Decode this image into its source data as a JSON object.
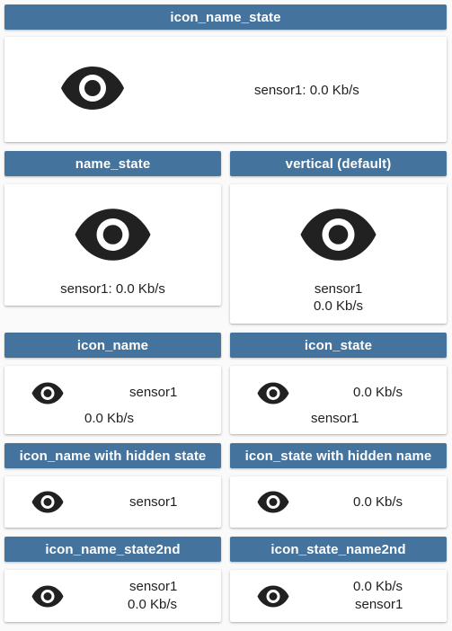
{
  "accent_color": "#44739e",
  "icon": "eye-icon",
  "cards": [
    {
      "title": "icon_name_state",
      "text": "sensor1: 0.0 Kb/s"
    },
    {
      "title": "name_state",
      "text": "sensor1: 0.0 Kb/s"
    },
    {
      "title": "vertical (default)",
      "name": "sensor1",
      "state": "0.0 Kb/s"
    },
    {
      "title": "icon_name",
      "name": "sensor1",
      "state": "0.0 Kb/s"
    },
    {
      "title": "icon_state",
      "state": "0.0 Kb/s",
      "name": "sensor1"
    },
    {
      "title": "icon_name with hidden state",
      "name": "sensor1"
    },
    {
      "title": "icon_state with hidden name",
      "state": "0.0 Kb/s"
    },
    {
      "title": "icon_name_state2nd",
      "name": "sensor1",
      "state": "0.0 Kb/s"
    },
    {
      "title": "icon_state_name2nd",
      "state": "0.0 Kb/s",
      "name": "sensor1"
    }
  ]
}
